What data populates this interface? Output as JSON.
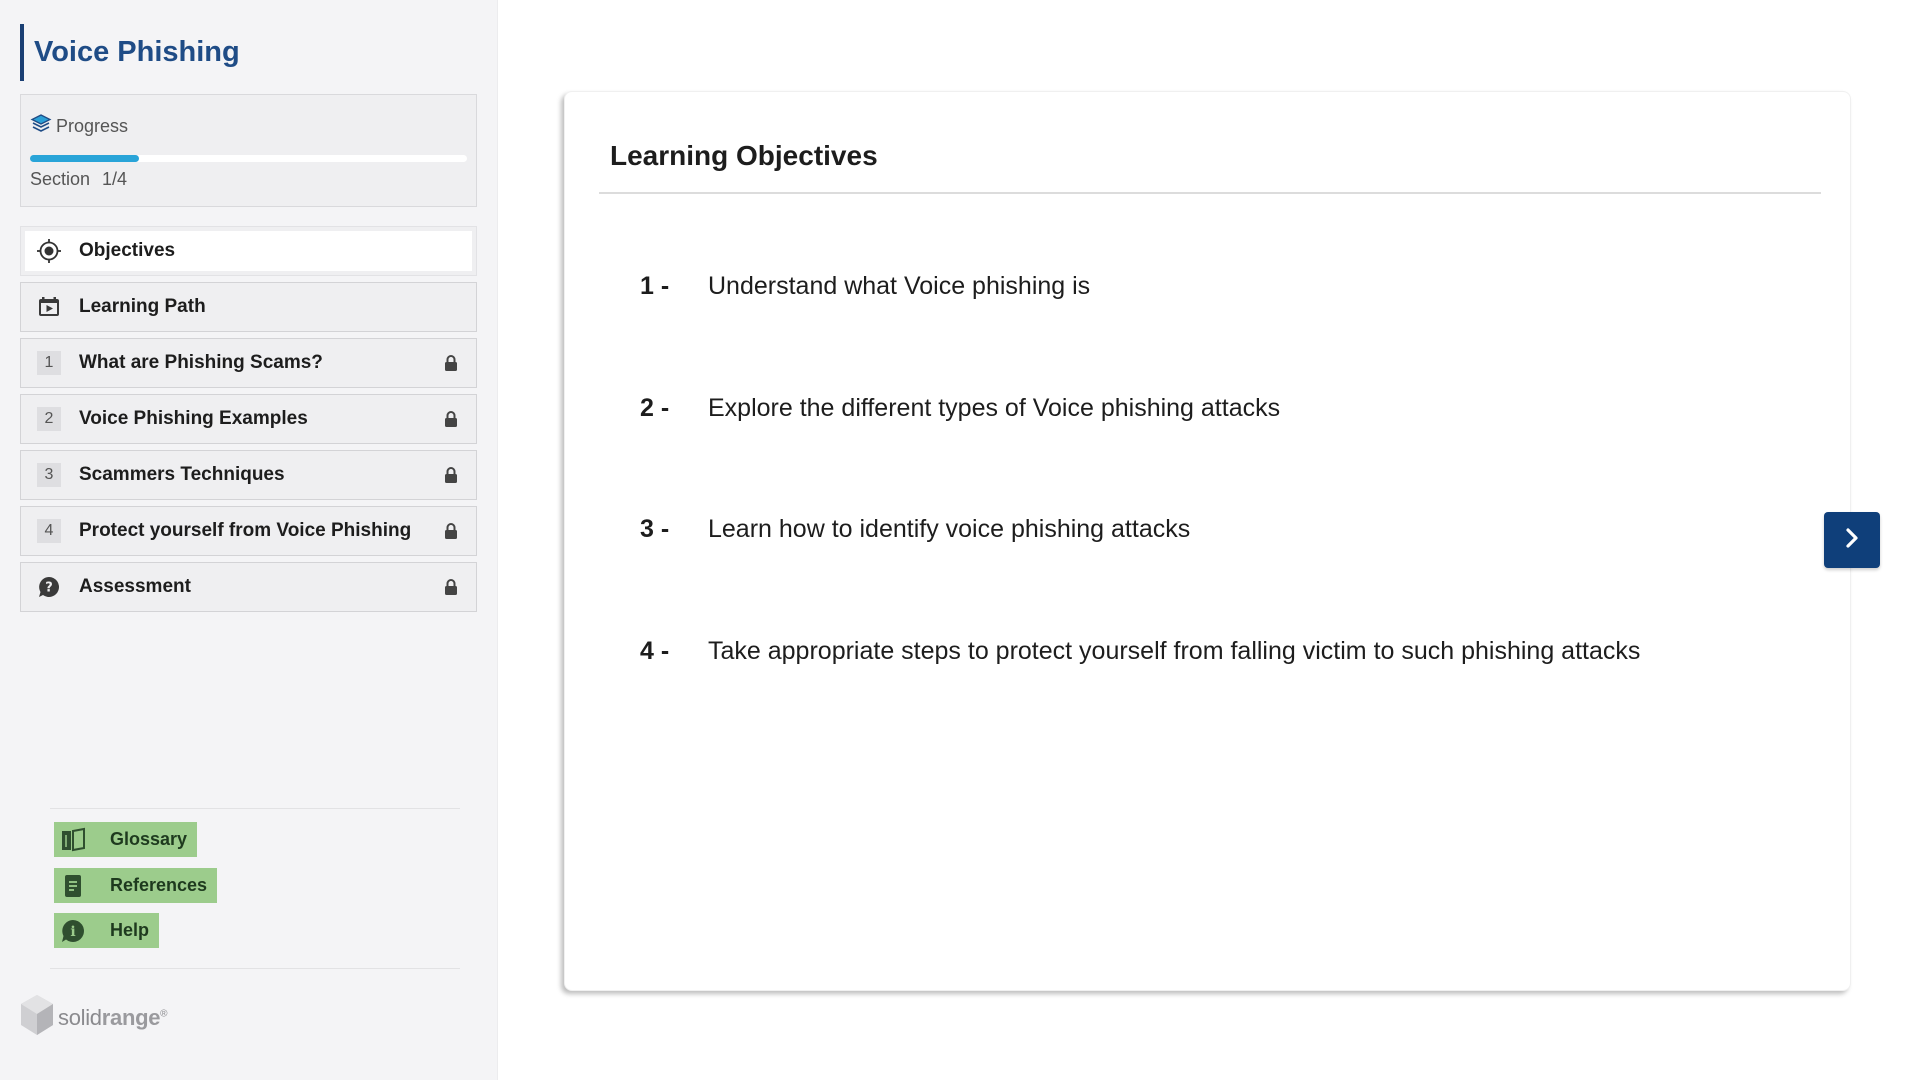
{
  "course": {
    "title": "Voice Phishing"
  },
  "progress": {
    "label": "Progress",
    "section_label": "Section",
    "section_value": "1/4",
    "fill_fraction": 0.25,
    "accent_color": "#29a4d8"
  },
  "nav": {
    "items": [
      {
        "label": "Objectives",
        "icon": "target-icon",
        "active": true,
        "locked": false
      },
      {
        "label": "Learning Path",
        "icon": "video-calendar-icon",
        "active": false,
        "locked": false
      },
      {
        "number": "1",
        "label": "What are Phishing Scams?",
        "locked": true
      },
      {
        "number": "2",
        "label": "Voice Phishing Examples",
        "locked": true
      },
      {
        "number": "3",
        "label": "Scammers Techniques",
        "locked": true
      },
      {
        "number": "4",
        "label": "Protect yourself from Voice Phishing",
        "locked": true
      },
      {
        "label": "Assessment",
        "icon": "question-bubble-icon",
        "locked": true
      }
    ]
  },
  "utilities": {
    "glossary": "Glossary",
    "references": "References",
    "help": "Help"
  },
  "brand": {
    "logo_text_a": "solid",
    "logo_text_b": "range",
    "logo_mark": "®"
  },
  "main": {
    "title": "Learning Objectives",
    "objectives": [
      {
        "num": "1 -",
        "text": "Understand what Voice phishing is"
      },
      {
        "num": "2 -",
        "text": "Explore the different types of Voice phishing attacks"
      },
      {
        "num": "3 -",
        "text": "Learn how to identify voice phishing attacks"
      },
      {
        "num": "4 -",
        "text": "Take appropriate steps to protect yourself from falling victim to such phishing attacks"
      }
    ]
  },
  "colors": {
    "title_blue": "#1f4c86",
    "next_button": "#0f3f7a",
    "utility_green": "#9ccc8c"
  }
}
